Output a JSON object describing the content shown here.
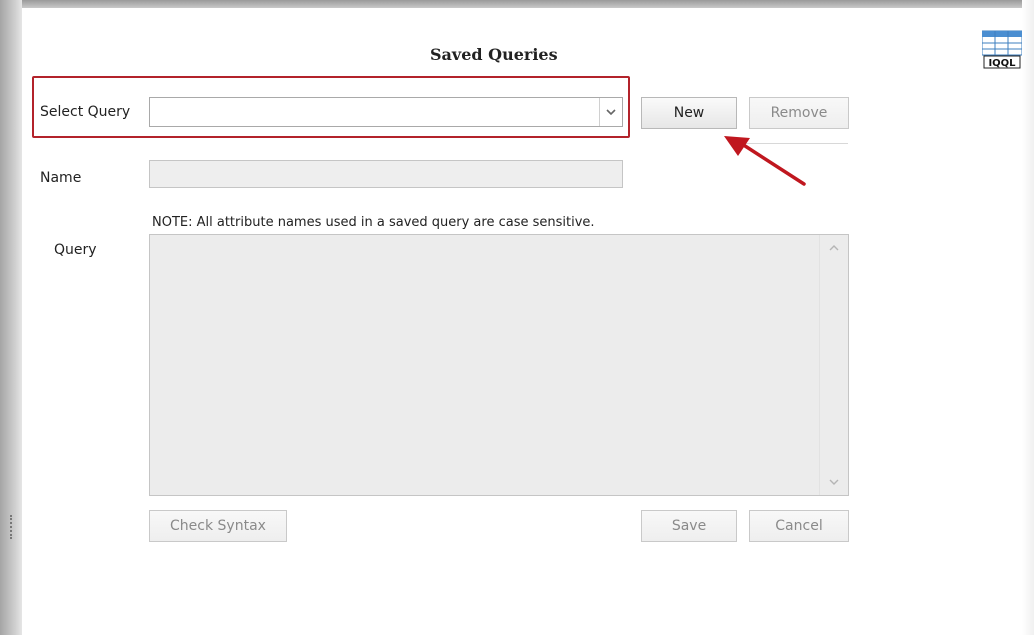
{
  "dialog": {
    "title": "Saved Queries",
    "select_query_label": "Select Query",
    "select_query_value": "",
    "name_label": "Name",
    "name_value": "",
    "note": "NOTE:  All attribute names used in a saved query are case sensitive.",
    "query_label": "Query",
    "query_value": ""
  },
  "buttons": {
    "new": "New",
    "remove": "Remove",
    "check_syntax": "Check Syntax",
    "save": "Save",
    "cancel": "Cancel"
  },
  "toolbar": {
    "iqql_icon_label": "IQQL"
  },
  "annotations": {
    "highlight_color": "#b3232b",
    "arrow_color": "#c0171f"
  },
  "icons": [
    "chevron-down-icon",
    "scroll-up-icon",
    "scroll-down-icon",
    "iqql-table-icon",
    "arrow-annotation-icon"
  ]
}
